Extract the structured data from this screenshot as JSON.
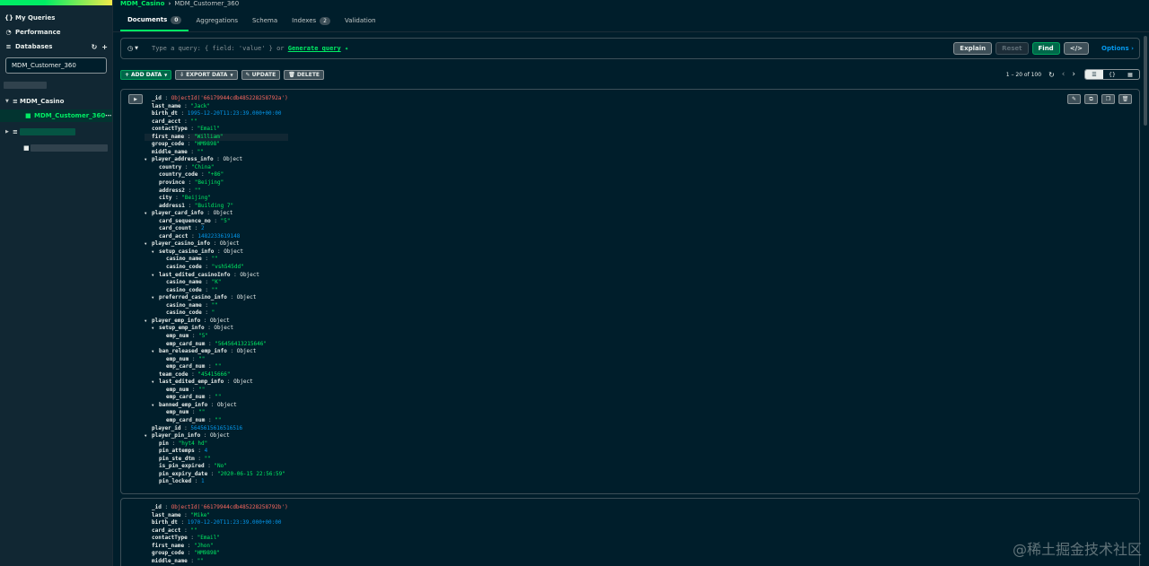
{
  "sidebar": {
    "my_queries": "My Queries",
    "performance": "Performance",
    "databases": "Databases",
    "search_value": "MDM_Customer_360",
    "db_name": "MDM_Casino",
    "collection_name": "MDM_Customer_360"
  },
  "breadcrumb": {
    "db": "MDM_Casino",
    "collection": "MDM_Customer_360"
  },
  "tabs": [
    {
      "label": "Documents",
      "count": "0"
    },
    {
      "label": "Aggregations"
    },
    {
      "label": "Schema"
    },
    {
      "label": "Indexes",
      "count": "2"
    },
    {
      "label": "Validation"
    }
  ],
  "query": {
    "placeholder": "Type a query: { field: 'value' } or",
    "generate": "Generate query",
    "explain": "Explain",
    "reset": "Reset",
    "find": "Find",
    "options": "Options"
  },
  "toolbar": {
    "add": "ADD DATA",
    "export": "EXPORT DATA",
    "update": "UPDATE",
    "delete": "DELETE",
    "range": "1 – 20 of 100"
  },
  "watermark": "@稀土掘金技术社区",
  "doc1": [
    {
      "d": 0,
      "k": "_id",
      "v": "ObjectId('66179944cdb485228258792a')",
      "t": "o"
    },
    {
      "d": 0,
      "k": "last_name",
      "v": "\"Jack\"",
      "t": "s"
    },
    {
      "d": 0,
      "k": "birth_dt",
      "v": "1995-12-20T11:23:39.000+00:00",
      "t": "n"
    },
    {
      "d": 0,
      "k": "card_acct",
      "v": "\"\"",
      "t": "s"
    },
    {
      "d": 0,
      "k": "contactType",
      "v": "\"Email\"",
      "t": "s"
    },
    {
      "d": 0,
      "k": "first_name",
      "v": "\"William\"",
      "t": "s"
    },
    {
      "d": 0,
      "k": "group_code",
      "v": "\"HM9898\"",
      "t": "s"
    },
    {
      "d": 0,
      "k": "middle_name",
      "v": "\"\"",
      "t": "s"
    },
    {
      "d": 0,
      "k": "player_address_info",
      "v": "Object",
      "t": "t",
      "x": 1
    },
    {
      "d": 1,
      "k": "country",
      "v": "\"China\"",
      "t": "s"
    },
    {
      "d": 1,
      "k": "country_code",
      "v": "\"+86\"",
      "t": "s"
    },
    {
      "d": 1,
      "k": "province",
      "v": "\"Beijing\"",
      "t": "s"
    },
    {
      "d": 1,
      "k": "address2",
      "v": "\"\"",
      "t": "s"
    },
    {
      "d": 1,
      "k": "city",
      "v": "\"Beijing\"",
      "t": "s"
    },
    {
      "d": 1,
      "k": "address1",
      "v": "\"Building 7\"",
      "t": "s"
    },
    {
      "d": 0,
      "k": "player_card_info",
      "v": "Object",
      "t": "t",
      "x": 1
    },
    {
      "d": 1,
      "k": "card_sequence_no",
      "v": "\"5\"",
      "t": "s"
    },
    {
      "d": 1,
      "k": "card_count",
      "v": "2",
      "t": "n"
    },
    {
      "d": 1,
      "k": "card_acct",
      "v": "1482233619148",
      "t": "n"
    },
    {
      "d": 0,
      "k": "player_casino_info",
      "v": "Object",
      "t": "t",
      "x": 1
    },
    {
      "d": 1,
      "k": "setup_casino_info",
      "v": "Object",
      "t": "t",
      "x": 1
    },
    {
      "d": 2,
      "k": "casino_name",
      "v": "\"\"",
      "t": "s"
    },
    {
      "d": 2,
      "k": "casino_code",
      "v": "\"vsh545dd\"",
      "t": "s"
    },
    {
      "d": 1,
      "k": "last_edited_casinoInfo",
      "v": "Object",
      "t": "t",
      "x": 1
    },
    {
      "d": 2,
      "k": "casino_name",
      "v": "\"K\"",
      "t": "s"
    },
    {
      "d": 2,
      "k": "casino_code",
      "v": "\"\"",
      "t": "s"
    },
    {
      "d": 1,
      "k": "preferred_casino_info",
      "v": "Object",
      "t": "t",
      "x": 1
    },
    {
      "d": 2,
      "k": "casino_name",
      "v": "\"\"",
      "t": "s"
    },
    {
      "d": 2,
      "k": "casino_code",
      "v": "\"",
      "t": "s"
    },
    {
      "d": 0,
      "k": "player_emp_info",
      "v": "Object",
      "t": "t",
      "x": 1
    },
    {
      "d": 1,
      "k": "setup_emp_info",
      "v": "Object",
      "t": "t",
      "x": 1
    },
    {
      "d": 2,
      "k": "emp_num",
      "v": "\"5\"",
      "t": "s"
    },
    {
      "d": 2,
      "k": "emp_card_num",
      "v": "\"56456413215646\"",
      "t": "s"
    },
    {
      "d": 1,
      "k": "ban_released_emp_info",
      "v": "Object",
      "t": "t",
      "x": 1
    },
    {
      "d": 2,
      "k": "emp_num",
      "v": "\"\"",
      "t": "s"
    },
    {
      "d": 2,
      "k": "emp_card_num",
      "v": "\"\"",
      "t": "s"
    },
    {
      "d": 1,
      "k": "team_code",
      "v": "\"45415666\"",
      "t": "s"
    },
    {
      "d": 1,
      "k": "last_edited_emp_info",
      "v": "Object",
      "t": "t",
      "x": 1
    },
    {
      "d": 2,
      "k": "emp_num",
      "v": "\"\"",
      "t": "s"
    },
    {
      "d": 2,
      "k": "emp_card_num",
      "v": "\"\"",
      "t": "s"
    },
    {
      "d": 1,
      "k": "banned_emp_info",
      "v": "Object",
      "t": "t",
      "x": 1
    },
    {
      "d": 2,
      "k": "emp_num",
      "v": "\"\"",
      "t": "s"
    },
    {
      "d": 2,
      "k": "emp_card_num",
      "v": "\"\"",
      "t": "s"
    },
    {
      "d": 0,
      "k": "player_id",
      "v": "5645615616516516",
      "t": "n"
    },
    {
      "d": 0,
      "k": "player_pin_info",
      "v": "Object",
      "t": "t",
      "x": 1
    },
    {
      "d": 1,
      "k": "pin",
      "v": "\"hyt4 hd\"",
      "t": "s"
    },
    {
      "d": 1,
      "k": "pin_attemps",
      "v": "4",
      "t": "n"
    },
    {
      "d": 1,
      "k": "pin_ste_dtm",
      "v": "\"\"",
      "t": "s"
    },
    {
      "d": 1,
      "k": "is_pin_expired",
      "v": "\"No\"",
      "t": "s"
    },
    {
      "d": 1,
      "k": "pin_expiry_date",
      "v": "\"2020-06-15 22:56:59\"",
      "t": "s"
    },
    {
      "d": 1,
      "k": "pin_locked",
      "v": "1",
      "t": "n"
    }
  ],
  "doc2": [
    {
      "d": 0,
      "k": "_id",
      "v": "ObjectId('66179944cdb485228258792b')",
      "t": "o"
    },
    {
      "d": 0,
      "k": "last_name",
      "v": "\"Mike\"",
      "t": "s"
    },
    {
      "d": 0,
      "k": "birth_dt",
      "v": "1970-12-20T11:23:39.000+00:00",
      "t": "n"
    },
    {
      "d": 0,
      "k": "card_acct",
      "v": "\"\"",
      "t": "s"
    },
    {
      "d": 0,
      "k": "contactType",
      "v": "\"Email\"",
      "t": "s"
    },
    {
      "d": 0,
      "k": "first_name",
      "v": "\"Jhon\"",
      "t": "s"
    },
    {
      "d": 0,
      "k": "group_code",
      "v": "\"HM9898\"",
      "t": "s"
    },
    {
      "d": 0,
      "k": "middle_name",
      "v": "\"\"",
      "t": "s"
    }
  ]
}
